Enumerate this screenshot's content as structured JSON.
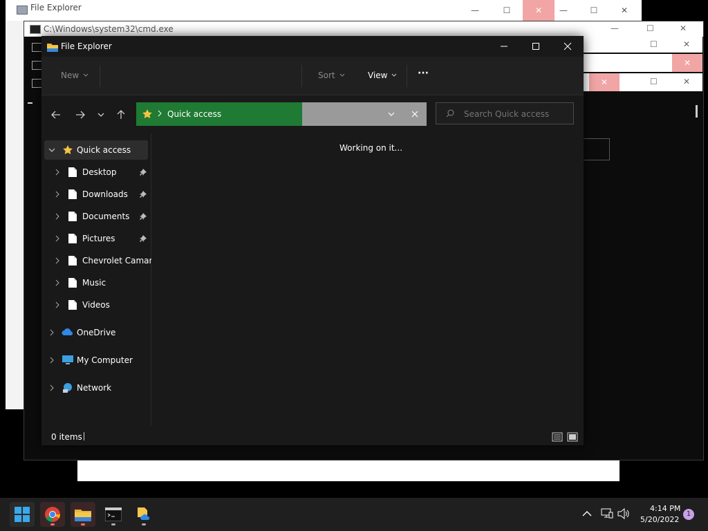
{
  "background_windows": {
    "explorer_back_title": "File Explorer",
    "cmd_title": "C:\\Windows\\system32\\cmd.exe"
  },
  "explorer": {
    "title": "File Explorer",
    "toolbar": {
      "new_label": "New",
      "sort_label": "Sort",
      "view_label": "View",
      "more_label": "···"
    },
    "address": {
      "location": "Quick access"
    },
    "search": {
      "placeholder": "Search Quick access"
    },
    "sidebar": {
      "quick_access": "Quick access",
      "items": [
        {
          "label": "Desktop",
          "pinned": true
        },
        {
          "label": "Downloads",
          "pinned": true
        },
        {
          "label": "Documents",
          "pinned": true
        },
        {
          "label": "Pictures",
          "pinned": true
        },
        {
          "label": "Chevrolet Camaro",
          "pinned": false
        },
        {
          "label": "Music",
          "pinned": false
        },
        {
          "label": "Videos",
          "pinned": false
        }
      ],
      "onedrive": "OneDrive",
      "my_computer": "My Computer",
      "network": "Network"
    },
    "content": {
      "status_message": "Working on it..."
    },
    "statusbar": {
      "items_count": "0 items"
    }
  },
  "taskbar": {
    "time": "4:14 PM",
    "date": "5/20/2022",
    "notification_count": "1"
  },
  "colors": {
    "address_green": "#1f7a33",
    "close_red": "#f1a5a5",
    "taskbar_bg": "#1f1f1f",
    "explorer_bg": "#191919"
  }
}
